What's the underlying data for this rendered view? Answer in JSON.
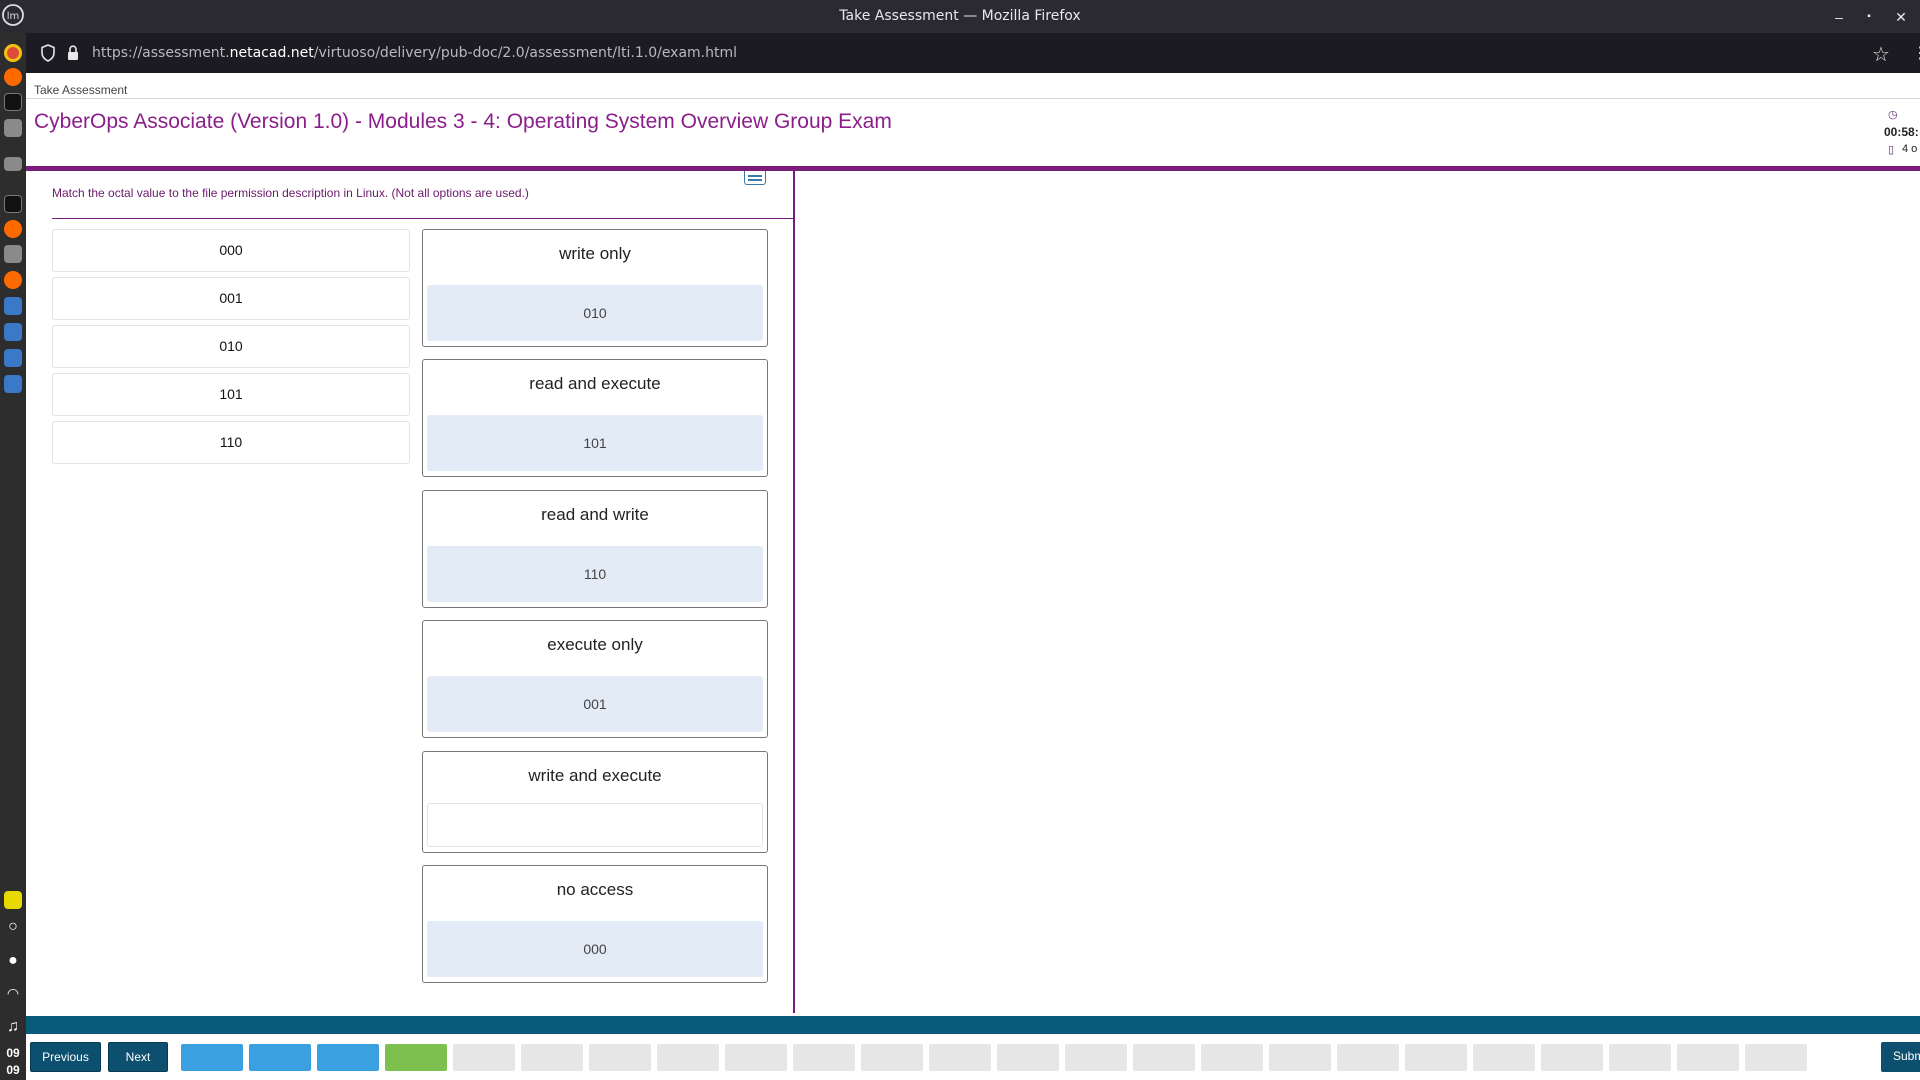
{
  "window": {
    "title": "Take Assessment — Mozilla Firefox",
    "controls": {
      "minimize": "‒",
      "maximize": "▪",
      "close": "✕"
    }
  },
  "browser": {
    "url_prefix": "https://assessment.",
    "url_domain": "netacad.net",
    "url_suffix": "/virtuoso/delivery/pub-doc/2.0/assessment/lti.1.0/exam.html"
  },
  "taskbar": {
    "clock_hour": "09",
    "clock_minute": "09"
  },
  "page": {
    "breadcrumb": "Take Assessment",
    "exam_title": "CyberOps Associate (Version 1.0) - Modules 3 - 4: Operating System Overview Group Exam",
    "timer": "00:58:",
    "progress": "4 o"
  },
  "question": {
    "instruction": "Match the octal value to the file permission description in Linux. (Not all options are used.)",
    "options": [
      "000",
      "001",
      "010",
      "101",
      "110"
    ],
    "targets": [
      {
        "label": "write only",
        "answer": "010"
      },
      {
        "label": "read and execute",
        "answer": "101"
      },
      {
        "label": "read and write",
        "answer": "110"
      },
      {
        "label": "execute only",
        "answer": "001"
      },
      {
        "label": "write and execute",
        "answer": ""
      },
      {
        "label": "no access",
        "answer": "000"
      }
    ]
  },
  "footer": {
    "previous_label": "Previous",
    "next_label": "Next",
    "submit_label": "Submit",
    "question_states": [
      "done",
      "done",
      "done",
      "current",
      "unanswered",
      "unanswered",
      "unanswered",
      "unanswered",
      "unanswered",
      "unanswered",
      "unanswered",
      "unanswered",
      "unanswered",
      "unanswered",
      "unanswered",
      "unanswered",
      "unanswered",
      "unanswered",
      "unanswered",
      "unanswered",
      "unanswered",
      "unanswered",
      "unanswered",
      "unanswered"
    ]
  },
  "colors": {
    "brand_purple": "#7a1d7a",
    "title_purple": "#8b1e8b",
    "nav_blue": "#0d4f6e",
    "answered_blue": "#3aa0e0",
    "current_green": "#7dc050"
  }
}
